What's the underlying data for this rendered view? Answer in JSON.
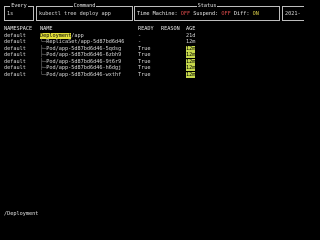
{
  "topbar": {
    "every": {
      "title": "Every",
      "value": "1s"
    },
    "command": {
      "title": "Command",
      "value": "kubectl tree deploy app"
    },
    "status": {
      "title": "Status",
      "time_machine_label": "Time Machine:",
      "time_machine_value": "OFF",
      "suspend_label": "Suspend:",
      "suspend_value": "OFF",
      "diff_label": "Diff:",
      "diff_value": "ON"
    },
    "extra": {
      "value": "2021-"
    }
  },
  "table": {
    "headers": [
      "NAMESPACE",
      "NAME",
      "READY",
      "REASON",
      "AGE"
    ],
    "rows": [
      {
        "ns": "default",
        "name_highlight": "Deployment",
        "name_rest": "/app",
        "ready": "-",
        "reason": "",
        "age": "21d"
      },
      {
        "ns": "default",
        "name_prefix": "└─",
        "name": "ReplicaSet/app-5d87bd6d46",
        "ready": "-",
        "reason": "",
        "age": "12m"
      },
      {
        "ns": "default",
        "name_prefix": "  ├─",
        "name": "Pod/app-5d87bd6d46-5qdsg",
        "ready": "True",
        "reason": "",
        "age": "12m"
      },
      {
        "ns": "default",
        "name_prefix": "  ├─",
        "name": "Pod/app-5d87bd6d46-6zbh9",
        "ready": "True",
        "reason": "",
        "age": "12m"
      },
      {
        "ns": "default",
        "name_prefix": "  ├─",
        "name": "Pod/app-5d87bd6d46-9t6r9",
        "ready": "True",
        "reason": "",
        "age": "12m"
      },
      {
        "ns": "default",
        "name_prefix": "  ├─",
        "name": "Pod/app-5d87bd6d46-h6dgj",
        "ready": "True",
        "reason": "",
        "age": "12m"
      },
      {
        "ns": "default",
        "name_prefix": "  └─",
        "name": "Pod/app-5d87bd6d46-wxthf",
        "ready": "True",
        "reason": "",
        "age": "12m"
      }
    ]
  },
  "footer": {
    "cmdline": "/Deployment"
  }
}
